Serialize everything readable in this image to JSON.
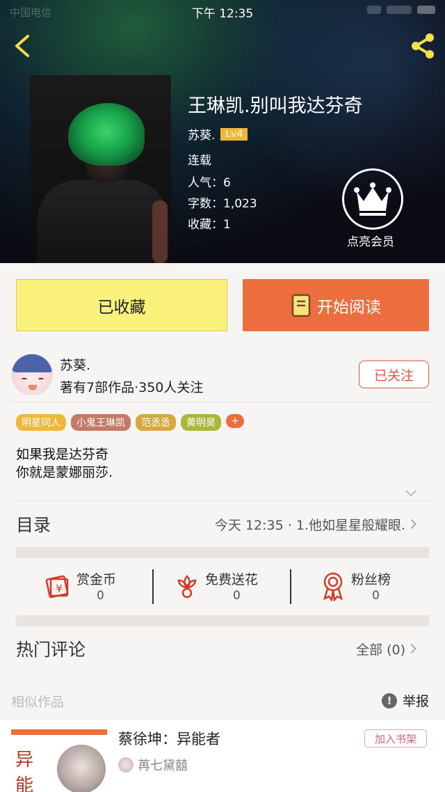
{
  "status": {
    "carrier": "中国电信",
    "time": "下午 12:35",
    "battery": "100%"
  },
  "book": {
    "title": "王琳凯.别叫我达芬奇",
    "author": "苏葵.",
    "level": "Lv4",
    "serial_status": "连载",
    "popularity_label": "人气：",
    "popularity": "6",
    "words_label": "字数：",
    "words": "1,023",
    "favorites_label": "收藏：",
    "favorites": "1"
  },
  "vip": {
    "label": "点亮会员"
  },
  "buttons": {
    "collected": "已收藏",
    "read": "开始阅读"
  },
  "author_card": {
    "name": "苏葵.",
    "stats": "著有7部作品·350人关注",
    "follow_label": "已关注"
  },
  "tags": [
    {
      "label": "明星同人",
      "color": "#f0b83a"
    },
    {
      "label": "小鬼王琳凯",
      "color": "#c57a66"
    },
    {
      "label": "范丞丞",
      "color": "#d7a83d"
    },
    {
      "label": "黄明昊",
      "color": "#a8b83a"
    }
  ],
  "tag_more": "+",
  "intro": {
    "line1": "如果我是达芬奇",
    "line2": "你就是蒙娜丽莎."
  },
  "toc": {
    "label": "目录",
    "latest": "今天 12:35 · 1.他如星星般耀眼."
  },
  "actions": [
    {
      "label": "赏金币",
      "count": "0",
      "icon": "coin-envelope-icon"
    },
    {
      "label": "免费送花",
      "count": "0",
      "icon": "flower-icon"
    },
    {
      "label": "粉丝榜",
      "count": "0",
      "icon": "medal-icon"
    }
  ],
  "comments": {
    "label": "热门评论",
    "all_label": "全部 (0)"
  },
  "similar": {
    "label": "相似作品",
    "report_label": "举报",
    "items": [
      {
        "title": "蔡徐坤：异能者",
        "author": "苒七黛囍",
        "cover_text_1": "异",
        "cover_text_2": "能",
        "shelf_label": "加入书架"
      }
    ]
  },
  "colors": {
    "accent": "#ec6d3d",
    "collected_bg": "#fbf27c",
    "follow_border": "#e0573c",
    "level_badge": "#f0b83a"
  }
}
